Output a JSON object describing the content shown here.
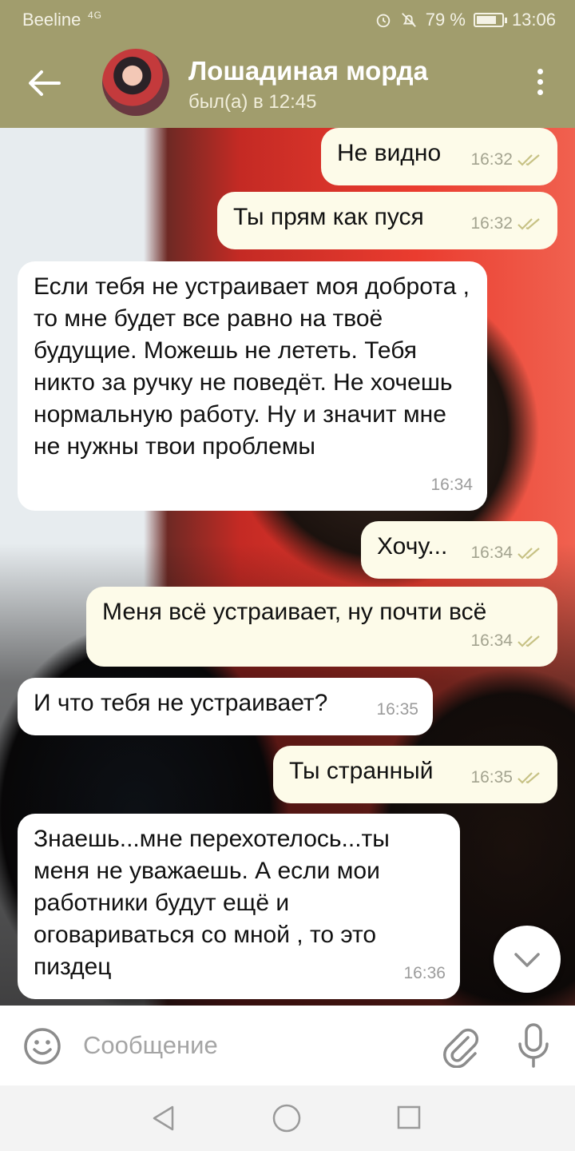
{
  "status_bar": {
    "carrier": "Beeline",
    "network": "4G",
    "battery": "79 %",
    "battery_level": 0.79,
    "time": "13:06"
  },
  "header": {
    "title": "Лошадиная морда",
    "status": "был(а) в 12:45"
  },
  "messages": [
    {
      "direction": "out",
      "text": "Не видно",
      "time": "16:32",
      "read": true
    },
    {
      "direction": "out",
      "text": "Ты прям как пуся",
      "time": "16:32",
      "read": true
    },
    {
      "direction": "in",
      "text": "Если тебя не устраивает моя доброта , то мне будет все равно на твоё будущие. Можешь не лететь. Тебя никто за ручку не поведёт. Не хочешь нормальную работу. Ну и значит мне не нужны твои проблемы",
      "time": "16:34"
    },
    {
      "direction": "out",
      "text": "Хочу...",
      "time": "16:34",
      "read": true
    },
    {
      "direction": "out",
      "text": "Меня всё устраивает, ну почти всё",
      "time": "16:34",
      "read": true
    },
    {
      "direction": "in",
      "text": "И что тебя не устраивает?",
      "time": "16:35"
    },
    {
      "direction": "out",
      "text": "Ты странный",
      "time": "16:35",
      "read": true
    },
    {
      "direction": "in",
      "text": "Знаешь...мне перехотелось...ты меня не уважаешь. А если мои работники будут ещё и оговариваться со мной , то это пиздец",
      "time": "16:36"
    }
  ],
  "input": {
    "placeholder": "Сообщение",
    "value": ""
  },
  "colors": {
    "header": "#a19d6d",
    "outgoing_bubble": "#fdfbe9",
    "incoming_bubble": "#ffffff",
    "read_ticks": "#c7c285"
  }
}
